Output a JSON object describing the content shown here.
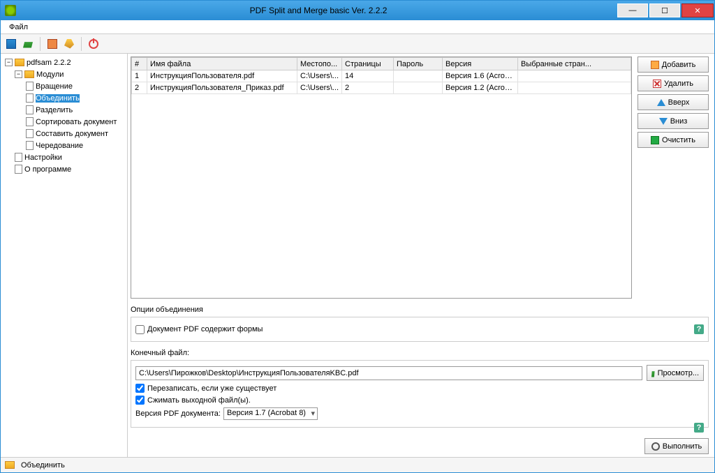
{
  "window": {
    "title": "PDF Split and Merge basic Ver. 2.2.2"
  },
  "menu": {
    "file": "Файл"
  },
  "tree": {
    "root": "pdfsam 2.2.2",
    "modules": "Модули",
    "items": [
      "Вращение",
      "Объединить",
      "Разделить",
      "Сортировать документ",
      "Составить документ",
      "Чередование"
    ],
    "settings": "Настройки",
    "about": "О программе"
  },
  "table": {
    "headers": {
      "num": "#",
      "filename": "Имя файла",
      "location": "Местопо...",
      "pages": "Страницы",
      "password": "Пароль",
      "version": "Версия",
      "selected": "Выбранные стран..."
    },
    "rows": [
      {
        "num": "1",
        "filename": "ИнструкцияПользователя.pdf",
        "location": "C:\\Users\\...",
        "pages": "14",
        "password": "",
        "version": "Версия 1.6 (Acroba..."
      },
      {
        "num": "2",
        "filename": "ИнструкцияПользователя_Приказ.pdf",
        "location": "C:\\Users\\...",
        "pages": "2",
        "password": "",
        "version": "Версия 1.2 (Acroba..."
      }
    ]
  },
  "buttons": {
    "add": "Добавить",
    "remove": "Удалить",
    "up": "Вверх",
    "down": "Вниз",
    "clear": "Очистить",
    "browse": "Просмотр...",
    "execute": "Выполнить"
  },
  "options": {
    "merge_title": "Опции объединения",
    "contains_forms": "Документ PDF содержит формы",
    "output_label": "Конечный файл:",
    "output_path": "C:\\Users\\Пирожков\\Desktop\\ИнструкцияПользователяKBC.pdf",
    "overwrite": "Перезаписать, если уже существует",
    "compress": "Сжимать выходной файл(ы).",
    "pdfver_label": "Версия PDF документа:",
    "pdfver_value": "Версия 1.7 (Acrobat 8)"
  },
  "status": {
    "label": "Объединить"
  }
}
